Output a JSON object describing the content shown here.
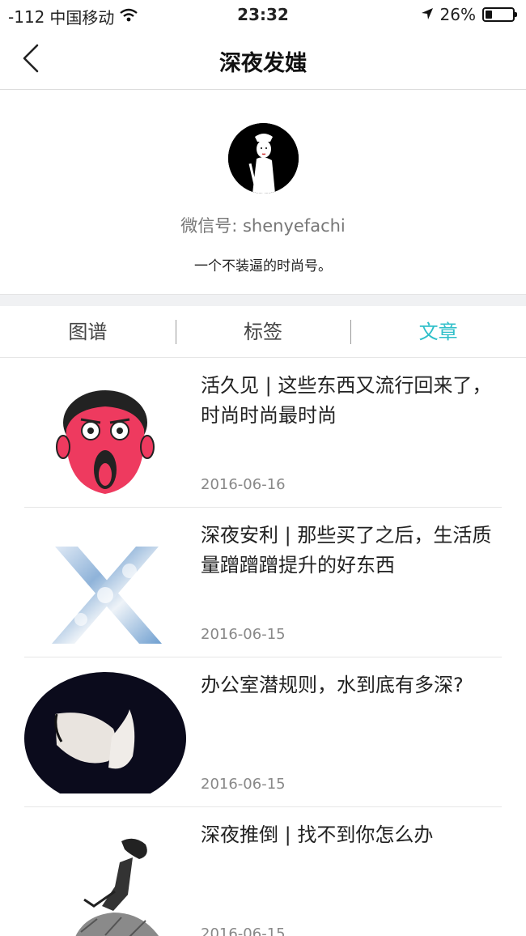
{
  "status_bar": {
    "signal": "-112",
    "carrier": "中国移动",
    "time": "23:32",
    "battery": "26%",
    "battery_level": 0.26
  },
  "nav": {
    "title": "深夜发媸"
  },
  "profile": {
    "wechat_id": "微信号: shenyefachi",
    "bio": "一个不装逼的时尚号。"
  },
  "tabs": [
    {
      "label": "图谱",
      "active": false
    },
    {
      "label": "标签",
      "active": false
    },
    {
      "label": "文章",
      "active": true
    }
  ],
  "articles": [
    {
      "title": "活久见 | 这些东西又流行回来了，时尚时尚最时尚",
      "date": "2016-06-16",
      "thumb": "red-face-cartoon"
    },
    {
      "title": "深夜安利 | 那些买了之后，生活质量蹭蹭蹭提升的好东西",
      "date": "2016-06-15",
      "thumb": "cloud-x"
    },
    {
      "title": "办公室潜规则，水到底有多深?",
      "date": "2016-06-15",
      "thumb": "kiss-photo"
    },
    {
      "title": "深夜推倒 | 找不到你怎么办",
      "date": "2016-06-15",
      "thumb": "sketch-woman"
    }
  ],
  "colors": {
    "accent": "#2fbfc9",
    "divider": "#e6e6e6",
    "section_gap": "#f0f1f3"
  }
}
